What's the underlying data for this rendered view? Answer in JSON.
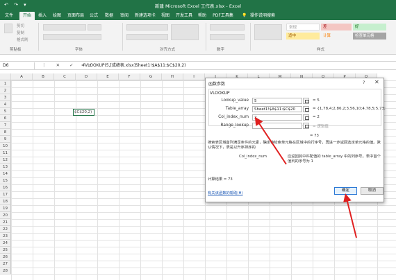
{
  "window": {
    "title": "新建 Microsoft Excel 工作表.xlsx - Excel",
    "qat": "↶  ↷  ▾"
  },
  "tabs": [
    "文件",
    "开始",
    "插入",
    "绘图",
    "页面布局",
    "公式",
    "数据",
    "审阅",
    "视图",
    "新建选项卡",
    "视图",
    "开发工具",
    "帮助",
    "PDF工具集",
    "操作说明搜索"
  ],
  "ribbon": {
    "clipboard": {
      "label": "剪贴板",
      "cut": "剪切",
      "copy": "复制",
      "format_painter": "格式刷"
    },
    "font_label": "字体",
    "align_label": "对齐方式",
    "number_label": "数字",
    "styles_label": "样式",
    "styles": {
      "normal": "常规",
      "bad": "差",
      "good": "好",
      "neutral": "适中",
      "calc": "计算",
      "check_cell": "检查单元格"
    },
    "colors": {
      "bad": "#f4c7c3",
      "good": "#c6efce",
      "neutral": "#ffeb9c",
      "calc": "#f2f2f2",
      "check": "#a5a5a5"
    }
  },
  "formula_bar": {
    "name_box": "D6",
    "icons": "⋮ ✕ ✓ fx",
    "formula": "=VLOOKUP(5,[成绩表.xlsx]Sheet1!$A$11:$C$20,2)"
  },
  "grid": {
    "columns": [
      "A",
      "B",
      "C",
      "D",
      "E",
      "F",
      "G",
      "H",
      "I",
      "J",
      "K",
      "L",
      "M",
      "N",
      "O",
      "P",
      "Q",
      "R"
    ],
    "rows": [
      "1",
      "2",
      "3",
      "4",
      "5",
      "6",
      "7",
      "8",
      "9",
      "10",
      "11",
      "12",
      "13",
      "14",
      "15",
      "16",
      "17",
      "18",
      "19",
      "20",
      "21",
      "22",
      "23",
      "24",
      "25",
      "26",
      "27",
      "28"
    ],
    "active_cell_text": "$C$20,2)"
  },
  "dialog": {
    "title": "函数参数",
    "help": "?",
    "close": "✕",
    "function_name": "VLOOKUP",
    "args": [
      {
        "label": "Lookup_value",
        "value": "5",
        "result": "= 5"
      },
      {
        "label": "Table_array",
        "value": "Sheet1!$A$11:$C$20",
        "result": "= {1,78,4;2,86,2;3,56,10;4,78,5;5,73;"
      },
      {
        "label": "Col_index_num",
        "value": "2",
        "result": "= 2"
      },
      {
        "label": "Range_lookup",
        "value": "",
        "result": "= 逻辑值"
      }
    ],
    "func_result": "= 73",
    "description": "搜索表区域首列满足条件的元素，确定待检索单元格在区域中的行序号，再进一步返回选定单元格的值。默认情况下，表是以升序排序的",
    "arg_help_label": "Col_index_num",
    "arg_help_text": "应返回其中匹配值的 table_array 中的列序号。表中首个值列的序号为 1",
    "calc_result": "计算结果 =  73",
    "help_link": "有关该函数的帮助(H)",
    "ok": "确定",
    "cancel": "取消"
  }
}
